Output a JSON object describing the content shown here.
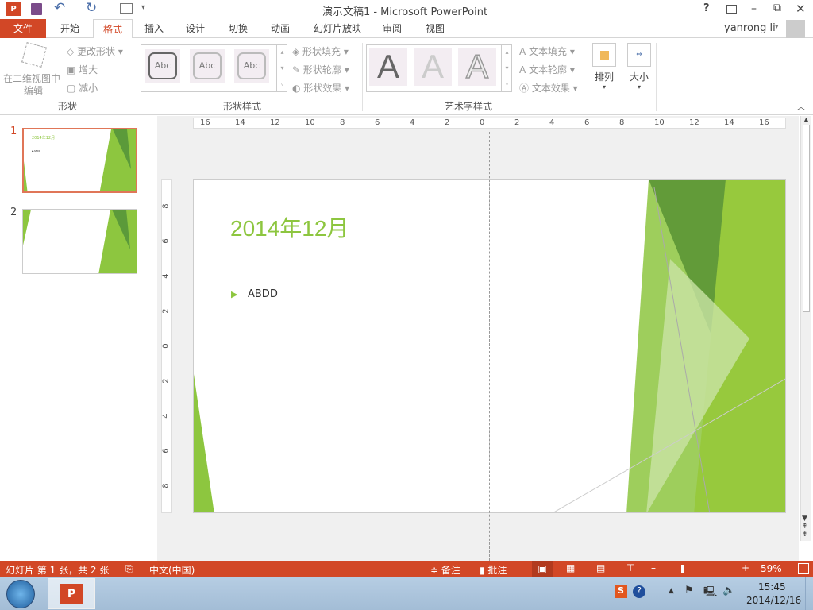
{
  "title": "演示文稿1 - Microsoft PowerPoint",
  "window_controls": {
    "help": "?",
    "minimize": "–",
    "restore": "⧉",
    "close": "✕"
  },
  "tabs": {
    "file": "文件",
    "home": "开始",
    "format": "格式",
    "insert": "插入",
    "design": "设计",
    "transitions": "切换",
    "animations": "动画",
    "slideshow": "幻灯片放映",
    "review": "审阅",
    "view": "视图"
  },
  "user": "yanrong li",
  "ribbon": {
    "edit_2d": "在二维视图中",
    "edit_2d_2": "编辑",
    "change_shape": "更改形状",
    "grow": "增大",
    "shrink": "减小",
    "group_shape": "形状",
    "abc": "Abc",
    "shape_fill": "形状填充",
    "shape_outline": "形状轮廓",
    "shape_effects": "形状效果",
    "group_shape_styles": "形状样式",
    "wordart_letter": "A",
    "text_fill": "文本填充",
    "text_outline": "文本轮廓",
    "text_effects": "文本效果",
    "group_wordart": "艺术字样式",
    "arrange": "排列",
    "size": "大小"
  },
  "thumbnails": [
    {
      "num": "1"
    },
    {
      "num": "2"
    }
  ],
  "ruler_h": [
    "16",
    "14",
    "12",
    "10",
    "8",
    "6",
    "4",
    "2",
    "0",
    "2",
    "4",
    "6",
    "8",
    "10",
    "12",
    "14",
    "16"
  ],
  "ruler_v": [
    "8",
    "6",
    "4",
    "2",
    "0",
    "2",
    "4",
    "6",
    "8"
  ],
  "slide": {
    "title": "2014年12月",
    "bullet": "ABDD"
  },
  "status": {
    "slide_info": "幻灯片 第 1 张，共 2 张",
    "language": "中文(中国)",
    "notes": "备注",
    "comments": "批注",
    "zoom": "59%",
    "zoom_value": 59
  },
  "taskbar": {
    "time": "15:45",
    "date": "2014/12/16"
  },
  "colors": {
    "accent": "#d24726",
    "green": "#8dc63f",
    "dark_green": "#5b9a3a"
  }
}
